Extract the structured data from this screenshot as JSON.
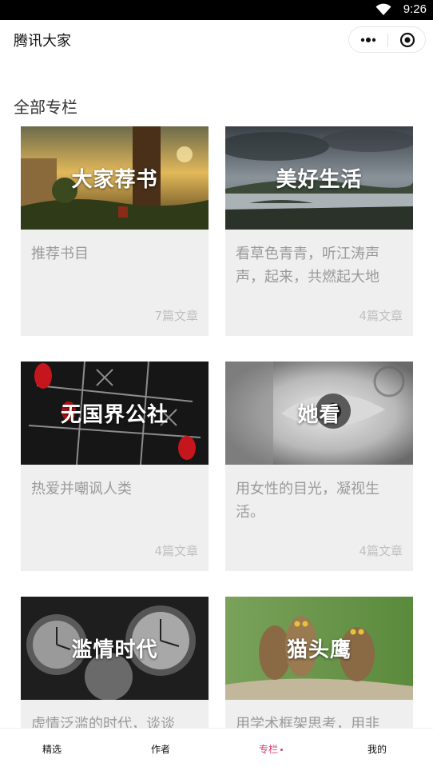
{
  "status_bar": {
    "time": "9:26",
    "wifi_icon": "wifi-icon"
  },
  "nav": {
    "title": "腾讯大家",
    "more_icon": "more-dots-icon",
    "close_icon": "target-close-icon"
  },
  "section_title": "全部专栏",
  "columns": [
    {
      "title": "大家荐书",
      "description": "推荐书目",
      "count": "7篇文章"
    },
    {
      "title": "美好生活",
      "description": "看草色青青，听江涛声声，起来，共燃起大地",
      "count": "4篇文章"
    },
    {
      "title": "无国界公社",
      "description": "热爱并嘲讽人类",
      "count": "4篇文章"
    },
    {
      "title": "她看",
      "description": "用女性的目光，凝视生活。",
      "count": "4篇文章"
    },
    {
      "title": "滥情时代",
      "description": "虚情泛滥的时代，谈谈",
      "count": ""
    },
    {
      "title": "猫头鹰",
      "description": "用学术框架思考，用非",
      "count": ""
    }
  ],
  "tabs": [
    {
      "label": "精选",
      "active": false
    },
    {
      "label": "作者",
      "active": false
    },
    {
      "label": "专栏",
      "active": true
    },
    {
      "label": "我的",
      "active": false
    }
  ],
  "colors": {
    "accent": "#d43a6a",
    "card_bg": "#efefef",
    "desc_text": "#9a9a9a"
  }
}
